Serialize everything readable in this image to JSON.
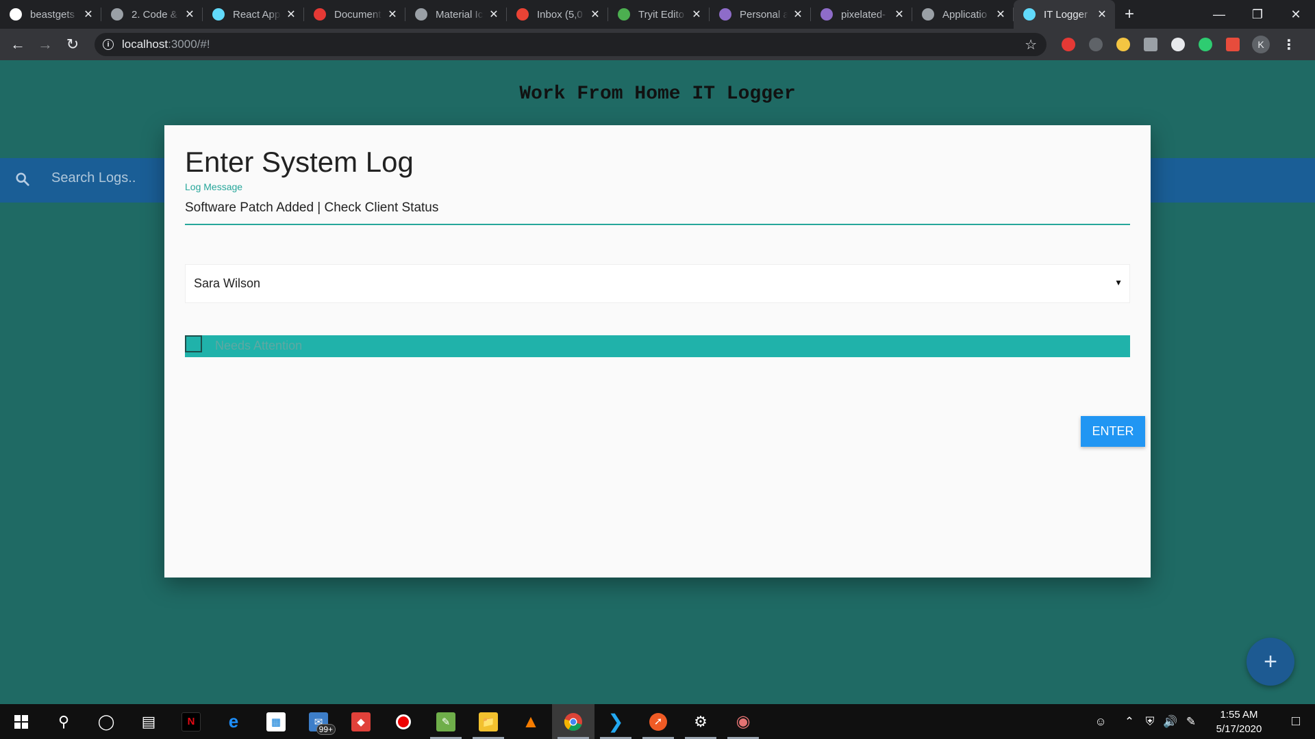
{
  "browser": {
    "tabs": [
      {
        "title": "beastgets",
        "favicon_color": "#ffffff",
        "icon": "github-icon"
      },
      {
        "title": "2. Code &",
        "favicon_color": "#9aa0a6",
        "icon": "globe-icon"
      },
      {
        "title": "React App",
        "favicon_color": "#61dafb",
        "icon": "react-icon"
      },
      {
        "title": "Document",
        "favicon_color": "#e53935",
        "icon": "document-icon"
      },
      {
        "title": "Material Ic",
        "favicon_color": "#9aa0a6",
        "icon": "globe-icon"
      },
      {
        "title": "Inbox (5,0",
        "favicon_color": "#ea4335",
        "icon": "gmail-icon"
      },
      {
        "title": "Tryit Edito",
        "favicon_color": "#4caf50",
        "icon": "w3-icon"
      },
      {
        "title": "Personal a",
        "favicon_color": "#8e6cc9",
        "icon": "heroku-icon"
      },
      {
        "title": "pixelated-",
        "favicon_color": "#8e6cc9",
        "icon": "heroku-icon"
      },
      {
        "title": "Applicatio",
        "favicon_color": "#9aa0a6",
        "icon": "globe-icon"
      },
      {
        "title": "IT Logger",
        "favicon_color": "#61dafb",
        "icon": "react-icon",
        "active": true
      }
    ],
    "address_host": "localhost",
    "address_rest": ":3000/#!",
    "profile_initial": "K"
  },
  "app": {
    "title": "Work From Home IT Logger",
    "search_placeholder": "Search Logs.."
  },
  "modal": {
    "heading": "Enter System Log",
    "message_label": "Log Message",
    "message_value": "Software Patch Added | Check Client Status",
    "tech_selected": "Sara Wilson",
    "attention_label": "Needs Attention",
    "attention_checked": false,
    "enter_label": "ENTER"
  },
  "fab_label": "+",
  "taskbar": {
    "mail_badge": "99+",
    "time": "1:55 AM",
    "date": "5/17/2020"
  },
  "colors": {
    "page_bg": "#1f6a64",
    "search_bar": "#1a5e96",
    "accent_teal": "#26a69a",
    "attention_bar": "#20b2aa",
    "enter_button": "#2196f3"
  }
}
